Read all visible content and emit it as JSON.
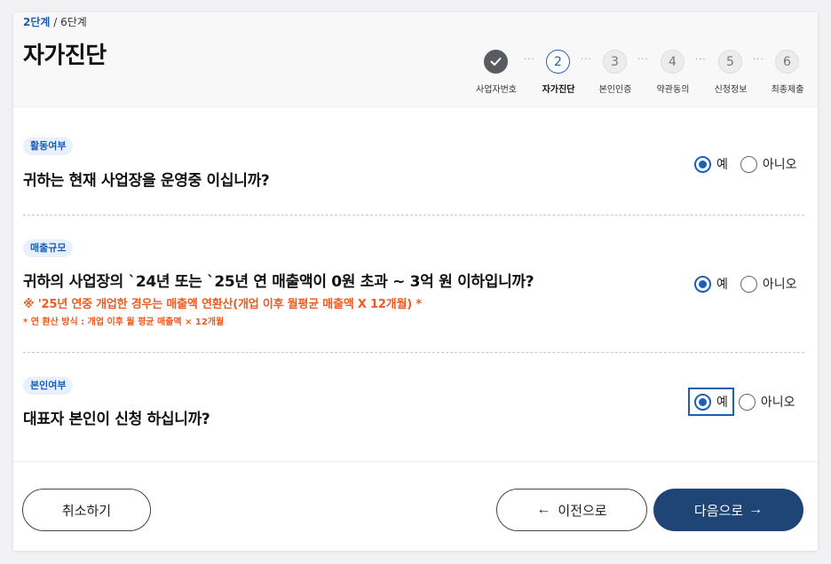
{
  "header": {
    "current_step": "2단계",
    "total_steps": "/ 6단계",
    "title": "자가진단"
  },
  "stepper": {
    "steps": [
      {
        "num": "",
        "label": "사업자번호",
        "state": "done"
      },
      {
        "num": "2",
        "label": "자가진단",
        "state": "active"
      },
      {
        "num": "3",
        "label": "본인인증",
        "state": "pending"
      },
      {
        "num": "4",
        "label": "약관동의",
        "state": "pending"
      },
      {
        "num": "5",
        "label": "신청정보",
        "state": "pending"
      },
      {
        "num": "6",
        "label": "최종제출",
        "state": "pending"
      }
    ],
    "separator": "···",
    "check_icon": "check-icon"
  },
  "questions": [
    {
      "tag": "활동여부",
      "text": "귀하는 현재 사업장을 운영중 이십니까?",
      "options": [
        "예",
        "아니오"
      ],
      "selected": "예"
    },
    {
      "tag": "매출규모",
      "text": "귀하의 사업장의 `24년 또는 `25년 연 매출액이 0원 초과 ~ 3억 원 이하입니까?",
      "note1": "※ '25년 연중 개업한 경우는 매출액 연환산(개업 이후 월평균 매출액 X 12개월) *",
      "note2": "* 연 환산 방식 : 개업 이후 월 평균 매출액 × 12개월",
      "options": [
        "예",
        "아니오"
      ],
      "selected": "예"
    },
    {
      "tag": "본인여부",
      "text": "대표자 본인이 신청 하십니까?",
      "options": [
        "예",
        "아니오"
      ],
      "selected": "예"
    }
  ],
  "footer": {
    "cancel_label": "취소하기",
    "prev_label": "이전으로",
    "prev_icon": "arrow-left-icon",
    "next_label": "다음으로",
    "next_icon": "arrow-right-icon"
  },
  "colors": {
    "accent": "#1c5fb8",
    "primary_button": "#1f4576",
    "note": "#ef5a1f"
  }
}
